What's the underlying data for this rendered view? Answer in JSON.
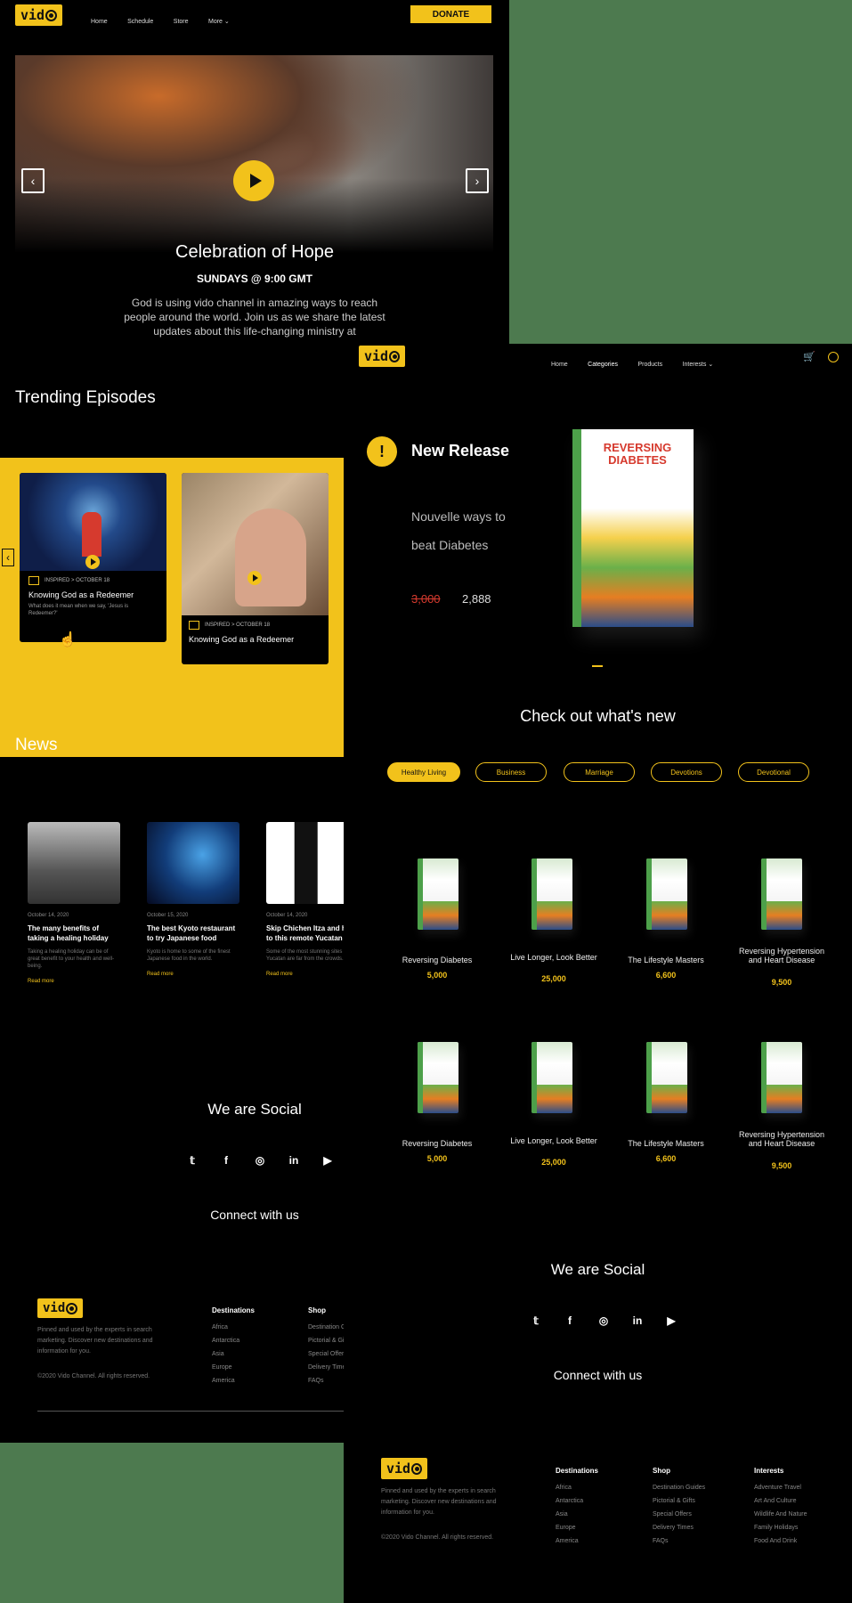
{
  "brand": {
    "logo_text": "vid",
    "accent": "#f2c21b"
  },
  "left": {
    "nav": [
      "Home",
      "Schedule",
      "Store",
      "More"
    ],
    "donate": "DONATE",
    "hero": {
      "title": "Celebration of Hope",
      "subtitle": "SUNDAYS @ 9:00 GMT",
      "text": "God is using vido channel in amazing ways to reach people around the world. Join us as we share the latest updates about this life-changing ministry at"
    },
    "trending_title": "Trending Episodes",
    "episodes": [
      {
        "meta": "INSPIRED > OCTOBER 18",
        "title": "Knowing God as a Redeemer",
        "desc": "What does it mean when we say, 'Jesus is Redeemer?'"
      },
      {
        "meta": "INSPIRED > OCTOBER 18",
        "title": "Knowing God as a Redeemer"
      }
    ],
    "news_title": "News",
    "news": [
      {
        "date": "October 14, 2020",
        "title": "The many benefits of taking a healing holiday",
        "excerpt": "Taking a healing holiday can be of great benefit to your health and well-being.",
        "link": "Read more"
      },
      {
        "date": "October 15, 2020",
        "title": "The best Kyoto restaurant to try Japanese food",
        "excerpt": "Kyoto is home to some of the finest Japanese food in the world.",
        "link": "Read more"
      },
      {
        "date": "October 14, 2020",
        "title": "Skip Chichen Itza and head to this remote Yucatan",
        "excerpt": "Some of the most stunning sites in Yucatan are far from the crowds.",
        "link": "Read more"
      }
    ],
    "social_title": "We are Social",
    "connect": "Connect with us",
    "footer": {
      "about": "Pinned and used by the experts in search marketing. Discover new destinations and information for you.",
      "copyright": "©2020 Vido Channel. All rights reserved.",
      "destinations_title": "Destinations",
      "destinations": [
        "Africa",
        "Antarctica",
        "Asia",
        "Europe",
        "America"
      ],
      "shop_title": "Shop",
      "shop": [
        "Destination Guides",
        "Pictorial & Gifts",
        "Special Offers",
        "Delivery Times",
        "FAQs"
      ]
    }
  },
  "right": {
    "nav": [
      "Home",
      "Categories",
      "Products",
      "Interests"
    ],
    "new_release": {
      "heading": "New Release",
      "desc": "Nouvelle ways to beat Diabetes",
      "old_price": "3,000",
      "price": "2,888",
      "book_title": "REVERSING DIABETES"
    },
    "whats_new": "Check out what's new",
    "filters": [
      "Healthy Living",
      "Business",
      "Marriage",
      "Devotions",
      "Devotional"
    ],
    "products": [
      {
        "title": "Reversing Diabetes",
        "price": "5,000"
      },
      {
        "title": "Live Longer, Look Better",
        "price": "25,000"
      },
      {
        "title": "The Lifestyle Masters",
        "price": "6,600"
      },
      {
        "title": "Reversing Hypertension and Heart Disease",
        "price": "9,500"
      },
      {
        "title": "Reversing Diabetes",
        "price": "5,000"
      },
      {
        "title": "Live Longer, Look Better",
        "price": "25,000"
      },
      {
        "title": "The Lifestyle Masters",
        "price": "6,600"
      },
      {
        "title": "Reversing Hypertension and Heart Disease",
        "price": "9,500"
      }
    ],
    "social_title": "We are Social",
    "connect": "Connect with us",
    "footer": {
      "about": "Pinned and used by the experts in search marketing. Discover new destinations and information for you.",
      "copyright": "©2020 Vido Channel. All rights reserved.",
      "destinations_title": "Destinations",
      "destinations": [
        "Africa",
        "Antarctica",
        "Asia",
        "Europe",
        "America"
      ],
      "shop_title": "Shop",
      "shop": [
        "Destination Guides",
        "Pictorial & Gifts",
        "Special Offers",
        "Delivery Times",
        "FAQs"
      ],
      "interests_title": "Interests",
      "interests": [
        "Adventure Travel",
        "Art And Culture",
        "Wildlife And Nature",
        "Family Holidays",
        "Food And Drink"
      ]
    }
  }
}
